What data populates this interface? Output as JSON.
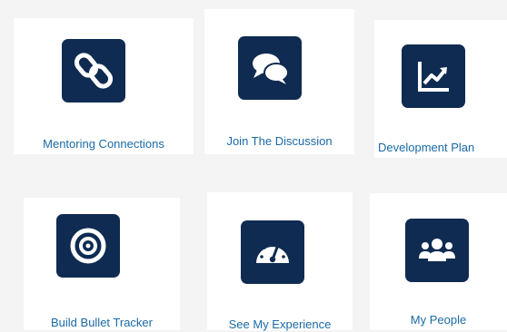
{
  "tiles": [
    {
      "label": "Mentoring Connections",
      "icon": "link-icon"
    },
    {
      "label": "Join The Discussion",
      "icon": "chat-bubbles-icon"
    },
    {
      "label": "Development Plan",
      "icon": "chart-line-icon"
    },
    {
      "label": "Build Bullet Tracker",
      "icon": "target-icon"
    },
    {
      "label": "See My Experience",
      "icon": "speedometer-icon"
    },
    {
      "label": "My People",
      "icon": "users-icon"
    }
  ],
  "colors": {
    "tile_background": "#0f2b52",
    "label_text": "#1a6aa6",
    "page_background": "#f4f4f4"
  }
}
